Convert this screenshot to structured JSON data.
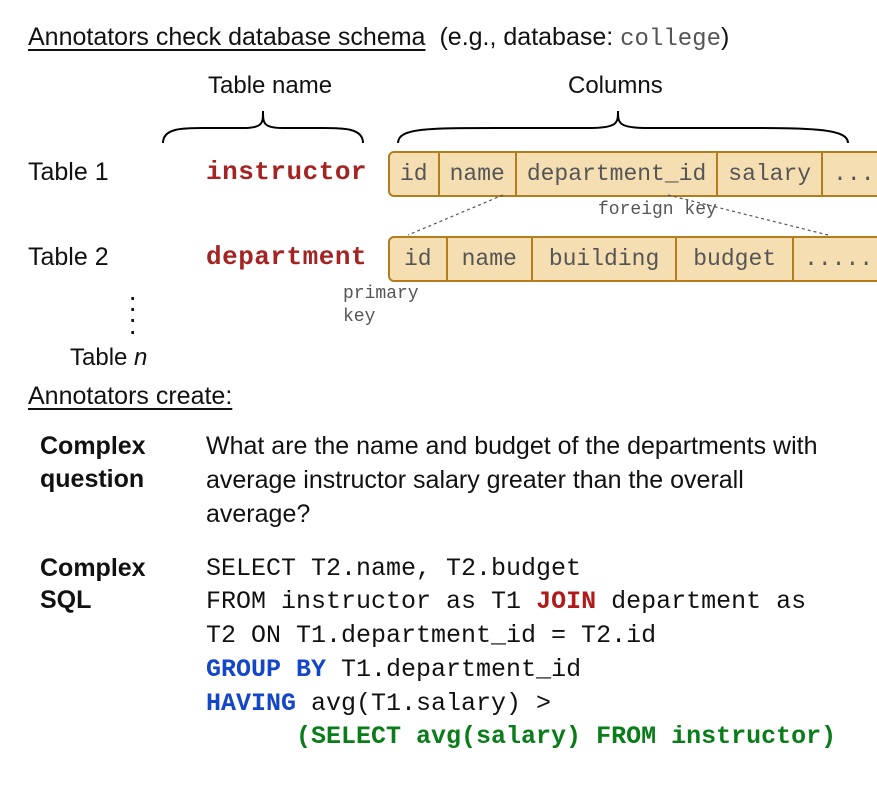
{
  "header": {
    "title": "Annotators check database schema",
    "eg_prefix": "(e.g., database: ",
    "eg_db": "college",
    "eg_suffix": ")"
  },
  "schema": {
    "table_name_label": "Table name",
    "columns_label": "Columns",
    "tables": [
      {
        "label": "Table 1",
        "name": "instructor",
        "columns": [
          "id",
          "name",
          "department_id",
          "salary",
          "...."
        ]
      },
      {
        "label": "Table 2",
        "name": "department",
        "columns": [
          "id",
          "name",
          "building",
          "budget",
          "......."
        ]
      }
    ],
    "foreign_key_label": "foreign key",
    "primary_key_label": "primary\nkey",
    "table_n_label": "Table n"
  },
  "create": {
    "title": "Annotators create:",
    "question_label": "Complex\nquestion",
    "question_text": "What are the name and budget of the departments with average instructor salary greater than the overall average?",
    "sql_label": "Complex\nSQL",
    "sql_tokens": [
      {
        "t": "SELECT T2.name, T2.budget"
      },
      {
        "t": "\n"
      },
      {
        "t": "FROM instructor as T1 "
      },
      {
        "t": "JOIN",
        "c": "kw-red"
      },
      {
        "t": " department as"
      },
      {
        "t": "\n"
      },
      {
        "t": "T2 ON T1.department_id = T2.id"
      },
      {
        "t": "\n"
      },
      {
        "t": "GROUP BY",
        "c": "kw-blue"
      },
      {
        "t": " T1.department_id"
      },
      {
        "t": "\n"
      },
      {
        "t": "HAVING",
        "c": "kw-blue"
      },
      {
        "t": " avg(T1.salary) >"
      },
      {
        "t": "\n"
      },
      {
        "t": "      "
      },
      {
        "t": "(SELECT avg(salary) FROM instructor)",
        "c": "kw-green"
      }
    ]
  }
}
